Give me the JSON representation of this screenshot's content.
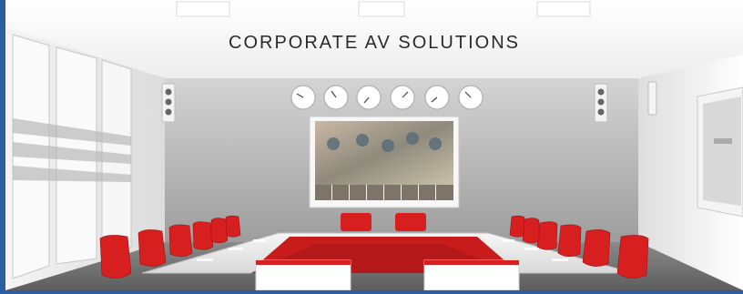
{
  "banner": {
    "title": "CORPORATE AV SOLUTIONS"
  },
  "scene": {
    "wall_clocks": 6,
    "video_tiles": 8,
    "colors": {
      "accent_red": "#d71f1f",
      "frame_blue": "#2b5ea0"
    }
  }
}
